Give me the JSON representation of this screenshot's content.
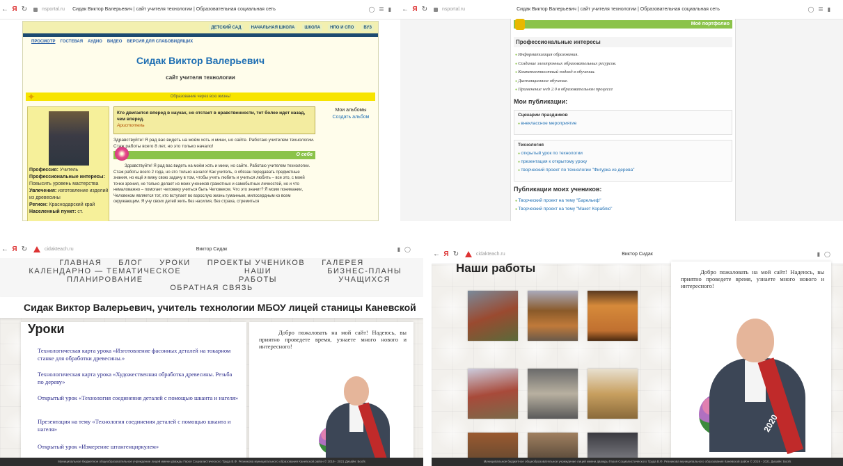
{
  "q1": {
    "browser": {
      "url": "nsportal.ru",
      "title": "Сидак Виктор Валерьевич | сайт учителя технологии | Образовательная социальная сеть"
    },
    "topnav": [
      "ДЕТСКИЙ САД",
      "НАЧАЛЬНАЯ ШКОЛА",
      "ШКОЛА",
      "НПО И СПО",
      "ВУЗ"
    ],
    "subnav": [
      "ПРОСМОТР",
      "ГОСТЕВАЯ",
      "АУДИО",
      "ВИДЕО",
      "ВЕРСИЯ ДЛЯ СЛАБОВИДЯЩИХ"
    ],
    "name": "Сидак Виктор Валерьевич",
    "site_label": "сайт учителя технологии",
    "motto": "Образование через всю жизнь!",
    "quote": "Кто двигается вперед в науках, но отстает в нравственности, тот более идет назад, чем вперед.",
    "quote_author": "Аристотель",
    "greeting": "Здравствуйте! Я рад вас видеть на моём хоть и мини, но сайте. Работаю учителем технологии. Стаж работы всего 8 лет, но это только начало!",
    "about_title": "О себе",
    "about_text": "Здравствуйте! Я рад вас видеть на моём хоть и мини, но сайте. Работаю учителем технологии. Стаж работы всего 2 года, но это только начало! Как учитель, я обязан передавать предметные знания, но ещё я вижу свою задачу в том, чтобы учить любить и учиться любить – все это, с моей точки зрения, не только делает из моих учеников грамотных и самобытных личностей, но и что немаловажно – помогает человеку учиться быть Человеком. Что это значит? Я моим понимании, Человеком является тот, кто вступает во взрослую жизнь гуманным, милосердным ко всем окружающим. Я учу своих детей жить без насилия, без страха, стремиться",
    "profile": {
      "profession_label": "Профессия:",
      "profession": "Учитель",
      "interests_label": "Профессиональные интересы:",
      "interests": "Повысить уровень мастерства",
      "hobby_label": "Увлечения:",
      "hobby": "изготовление изделий из древесины",
      "region_label": "Регион:",
      "region": "Краснодарский край",
      "place_label": "Населенный пункт:",
      "place": "ст."
    },
    "albums": {
      "title": "Мои альбомы",
      "create": "Создать альбом"
    }
  },
  "q2": {
    "browser": {
      "url": "nsportal.ru",
      "title": "Сидак Виктор Валерьевич | сайт учителя технологии | Образовательная социальная сеть"
    },
    "portfolio_bar": "Моё портфолио",
    "interests_title": "Профессиональные интересы",
    "interests": [
      "Информатизация образования.",
      "Создание электронных образовательных ресурсов.",
      "Компетентностный подход в обучении.",
      "Дистанционное обучение.",
      "Применение web 2.0 в образовательном процессе"
    ],
    "pubs_title": "Мои публикации:",
    "group1": {
      "title": "Сценарии праздников",
      "items": [
        "внеклассное мероприятие"
      ]
    },
    "group2": {
      "title": "Технология",
      "items": [
        "открытый урок по технологии",
        "презентация к открытому уроку",
        "творческий проект по технологии \"Фигурка из дерева\""
      ]
    },
    "students_title": "Публикации моих учеников:",
    "students": [
      "Творческий проект на тему \"Барельеф\"",
      "Творческий проект на тему \"Макет Кораблю\""
    ]
  },
  "q3": {
    "browser": {
      "url": "cidakteach.ru",
      "title": "Виктор Сидак"
    },
    "menu_row1": [
      "ГЛАВНАЯ",
      "БЛОГ",
      "УРОКИ",
      "ПРОЕКТЫ УЧЕНИКОВ",
      "ГАЛЕРЕЯ"
    ],
    "menu_row2": [
      "КАЛЕНДАРНО — ТЕМАТИЧЕСКОЕ ПЛАНИРОВАНИЕ",
      "НАШИ РАБОТЫ",
      "БИЗНЕС-ПЛАНЫ УЧАЩИХСЯ"
    ],
    "menu_row3": [
      "ОБРАТНАЯ СВЯЗЬ"
    ],
    "heading": "Сидак Виктор Валерьевич, учитель технологии МБОУ лицей станицы Каневской",
    "lessons_title": "Уроки",
    "lessons": [
      "Технологическая карта урока «Изготовление фасонных деталей на токарном станке для обработки древесины.»",
      "Технологическая карта урока «Художественная обработка древесины. Резьба по дереву»",
      "Открытый урок «Технология соединения деталей с помощью шканта и нагеля»",
      "Презентация на тему «Технология соединения деталей с помощью шканта и нагеля»",
      "Открытый урок «Измерение штангенциркулем»"
    ],
    "welcome": "Добро пожаловать на мой сайт! Надеюсь, вы приятно проведете время, узнаете много нового и интересного!",
    "footer": "Муниципальное бюджетное общеобразовательное учреждение лицей имени дважды Героя Социалистического Труда В.Ф. Резникова муниципального образования Каневской район © 2019 - 2021 Дизайн: Бооfs"
  },
  "q4": {
    "browser": {
      "url": "cidakteach.ru",
      "title": "Виктор Сидак"
    },
    "works_title": "Наши работы",
    "welcome": "Добро пожаловать на мой сайт! Надеюсь, вы приятно проведете время, узнаете много нового и интересного!",
    "sash_text": "2020",
    "footer": "Муниципальное бюджетное общеобразовательное учреждение лицей имени дважды Героя Социалистического Труда В.Ф. Резникова муниципального образования Каневской район © 2019 - 2021 Дизайн: Бооfs"
  }
}
